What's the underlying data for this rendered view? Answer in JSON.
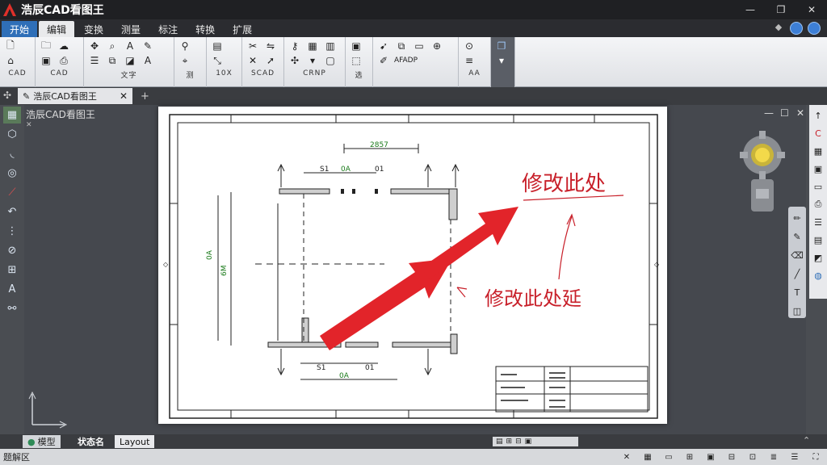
{
  "app": {
    "title": "浩辰CAD看图王",
    "logo": "app-logo-icon"
  },
  "window_controls": [
    "—",
    "❐",
    "✕"
  ],
  "menu": {
    "tabs": [
      {
        "label": "开始",
        "style": "home"
      },
      {
        "label": "编辑",
        "style": "active"
      },
      {
        "label": "变换",
        "style": ""
      },
      {
        "label": "测量",
        "style": ""
      },
      {
        "label": "标注",
        "style": ""
      },
      {
        "label": "转换",
        "style": ""
      },
      {
        "label": "扩展",
        "style": ""
      }
    ]
  },
  "ribbon": {
    "groups": [
      {
        "label": "CAD"
      },
      {
        "label": "CAD"
      },
      {
        "label": "文字"
      },
      {
        "label": "测"
      },
      {
        "label": "10X"
      },
      {
        "label": "SCAD"
      },
      {
        "label": "CRNP"
      },
      {
        "label": "选"
      },
      {
        "label": "AFADP"
      },
      {
        "label": "AA"
      }
    ]
  },
  "doc_tab": {
    "label": "浩辰CAD看图王",
    "close": "✕",
    "plus": "+"
  },
  "canvas": {
    "title": "浩辰CAD看图王",
    "min": "—",
    "max": "☐",
    "close": "✕"
  },
  "drawing": {
    "dim_top": "2857",
    "dim_top_labels": [
      "S1",
      "0A",
      "01"
    ],
    "dim_bottom_labels": [
      "S1",
      "0A",
      "01"
    ],
    "left_labels": [
      "0A",
      "6M"
    ],
    "annotation_1": "修改此处",
    "annotation_2": "修改此处延",
    "arrow_color": "#e2242a"
  },
  "layout_tabs": {
    "model": "模型",
    "layout1": "状态名",
    "layout2": "Layout"
  },
  "status": {
    "text": "题解区"
  }
}
